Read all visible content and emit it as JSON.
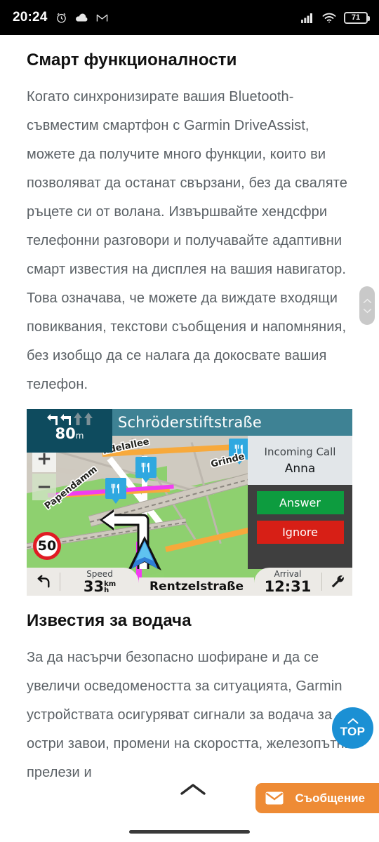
{
  "status_bar": {
    "time": "20:24",
    "icons_left": [
      "alarm-clock-icon",
      "cloud-icon",
      "gmail-icon"
    ],
    "icons_right": [
      "cellular-signal-icon",
      "wifi-icon",
      "battery-icon"
    ],
    "battery_percent": "71"
  },
  "article": {
    "section1_title": "Смарт функционалности",
    "section1_paragraph": "Когато синхронизирате вашия Bluetooth-съвместим смартфон с Garmin DriveAssist, можете да получите много функции, които ви позволяват да останат свързани, без да сваляте ръцете си от волана. Извършвайте хендсфри телефонни разговори и получавайте адаптивни смарт известия на дисплея на вашия навигатор. Това означава, че можете да виждате входящи повиквания, текстови съобщения и напомняния, без изобщо да се налага да докосвате вашия телефон.",
    "section2_title": "Известия за водача",
    "section2_paragraph": "За да насърчи безопасно шофиране и да се увеличи осведомеността за ситуацията, Garmin устройствата осигуряват сигнали за водача за остри завои, промени на скоростта, железопътни прелези и"
  },
  "gps_image": {
    "header_street": "Schröderstiftstraße",
    "turn_distance": "80",
    "turn_distance_unit": "m",
    "zoom_in_label": "+",
    "zoom_out_label": "−",
    "speed_limit": "50",
    "map_labels": [
      "Papendamm",
      "ndelallee",
      "Grinde"
    ],
    "poi_icon": "restaurant-icon",
    "call": {
      "title": "Incoming Call",
      "caller": "Anna",
      "answer_label": "Answer",
      "ignore_label": "Ignore"
    },
    "footer": {
      "back_icon": "back-arrow-icon",
      "speed_label": "Speed",
      "speed_value": "33",
      "speed_unit_top": "km",
      "speed_unit_bottom": "h",
      "current_street": "Rentzelstraße",
      "arrival_label": "Arrival",
      "arrival_value": "12:31",
      "tools_icon": "wrench-icon"
    }
  },
  "floating": {
    "top_button_label": "TOP",
    "top_button_icon": "chevron-up-icon",
    "scroll_top_icon": "chevron-up-icon",
    "message_button_label": "Съобщение",
    "message_button_icon": "envelope-icon"
  },
  "colors": {
    "accent_blue": "#1b90d4",
    "accent_orange": "#ee8b35",
    "gps_header_teal": "#3e8294",
    "gps_turnbox_teal": "#0e4b5e",
    "answer_green": "#0d9c3f",
    "ignore_red": "#d71f16",
    "body_text": "#5b6166"
  }
}
